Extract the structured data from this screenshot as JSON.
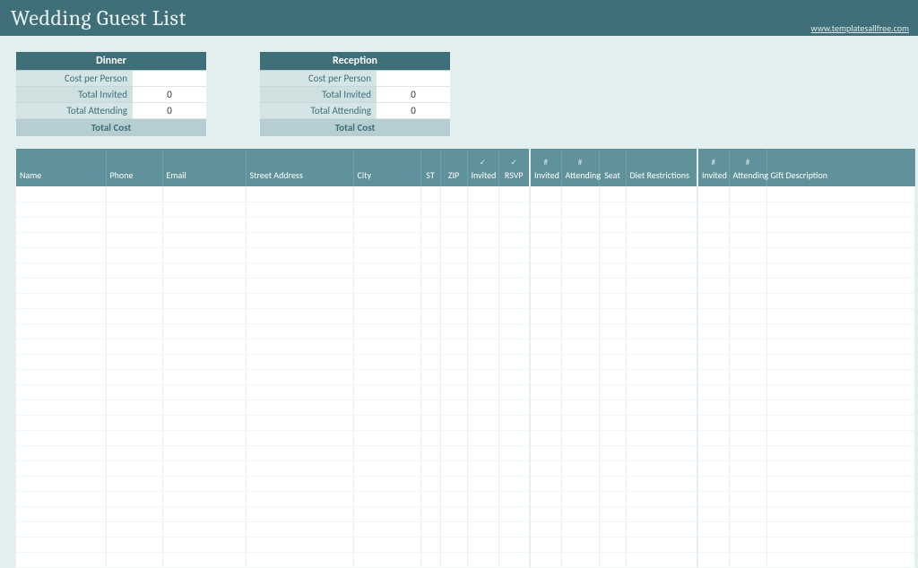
{
  "title": "Wedding Guest List",
  "link": "www.templatesallfree.com",
  "summaries": [
    {
      "key": "dinner",
      "title": "Dinner",
      "rows": [
        {
          "label": "Cost per Person",
          "value": ""
        },
        {
          "label": "Total Invited",
          "value": "0"
        },
        {
          "label": "Total Attending",
          "value": "0"
        }
      ],
      "total_label": "Total Cost"
    },
    {
      "key": "reception",
      "title": "Reception",
      "rows": [
        {
          "label": "Cost per Person",
          "value": ""
        },
        {
          "label": "Total Invited",
          "value": "0"
        },
        {
          "label": "Total Attending",
          "value": "0"
        }
      ],
      "total_label": "Total Cost"
    }
  ],
  "columns": {
    "name": "Name",
    "phone": "Phone",
    "email": "Email",
    "street": "Street Address",
    "city": "City",
    "st": "ST",
    "zip": "ZIP",
    "invited": "Invited",
    "rsvp": "RSVP",
    "invited2": "Invited",
    "attending2": "Attending",
    "seat": "Seat",
    "diet": "Diet Restrictions",
    "invited3": "Invited",
    "attending3": "Attending",
    "gift": "Gift Description"
  },
  "row_count": 25
}
